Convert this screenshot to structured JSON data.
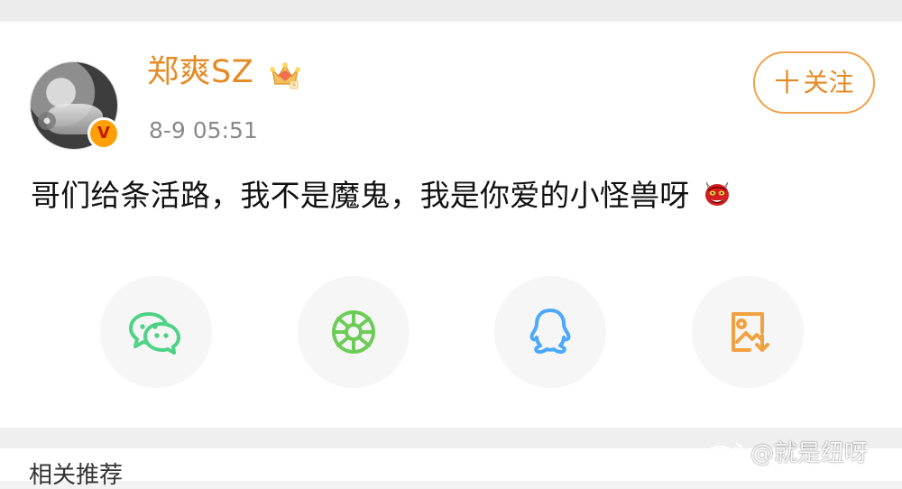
{
  "post": {
    "author_name": "郑爽SZ",
    "timestamp": "8-9 05:51",
    "follow_label": "关注",
    "follow_prefix": "十",
    "content": "哥们给条活路，我不是魔鬼，我是你爱的小怪兽呀"
  },
  "icons": {
    "verified": "verified-v-icon",
    "crown": "crown-icon",
    "demon_emoji": "demon-emoji-icon",
    "wechat": "wechat-icon",
    "moments": "moments-icon",
    "qq": "qq-icon",
    "save_image": "save-image-icon"
  },
  "badge": {
    "verified_text": "V"
  },
  "sections": {
    "related_title": "相关推荐"
  },
  "watermark": {
    "text": "@就是纽呀"
  },
  "colors": {
    "accent_orange": "#e58a24",
    "wechat_green": "#4fd286",
    "moments_green": "#6dcc57",
    "qq_blue": "#4aa8ff",
    "save_orange": "#f1a140"
  }
}
